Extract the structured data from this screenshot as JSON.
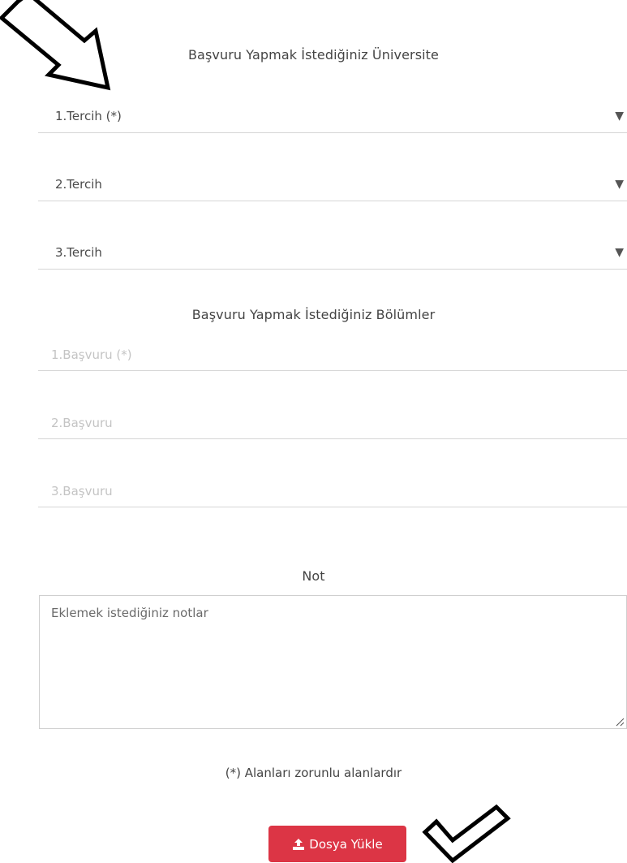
{
  "university_section": {
    "title": "Başvuru Yapmak İstediğiniz Üniversite",
    "choices": [
      {
        "label": "1.Tercih (*)"
      },
      {
        "label": "2.Tercih"
      },
      {
        "label": "3.Tercih"
      }
    ],
    "caret": "▼"
  },
  "department_section": {
    "title": "Başvuru Yapmak İstediğiniz Bölümler",
    "fields": [
      {
        "placeholder": "1.Başvuru (*)",
        "value": ""
      },
      {
        "placeholder": "2.Başvuru",
        "value": ""
      },
      {
        "placeholder": "3.Başvuru",
        "value": ""
      }
    ]
  },
  "note_section": {
    "title": "Not",
    "placeholder": "Eklemek istediğiniz notlar",
    "value": ""
  },
  "required_note": "(*) Alanları zorunlu alanlardır",
  "upload_button": {
    "label": "Dosya Yükle",
    "icon": "upload-icon",
    "color": "#dc3545"
  },
  "annotations": {
    "arrow_icon": "arrow-pointing-down-right-icon",
    "check_icon": "checkmark-icon"
  }
}
